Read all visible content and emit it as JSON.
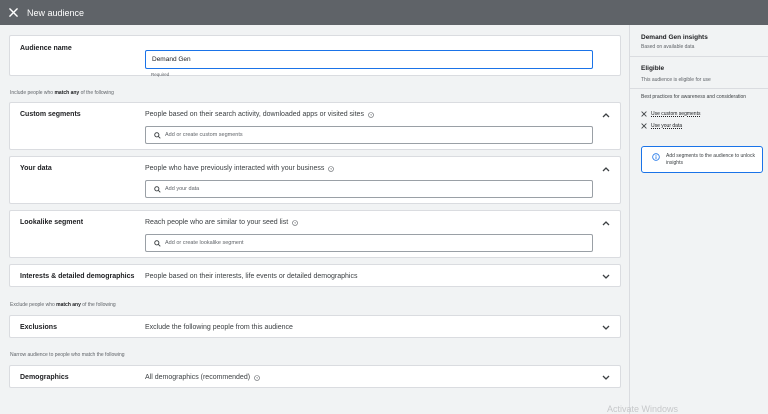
{
  "topbar": {
    "title": "New audience",
    "close_icon": "close-icon"
  },
  "audience_name": {
    "label": "Audience name",
    "value": "Demand Gen",
    "helper": "Required"
  },
  "include_caption": {
    "before": "Include people who ",
    "bold": "match any",
    "after": " of the following"
  },
  "custom_segments": {
    "label": "Custom segments",
    "description": "People based on their search activity, downloaded apps or visited sites",
    "placeholder": "Add or create custom segments"
  },
  "your_data": {
    "label": "Your data",
    "description": "People who have previously interacted with your business",
    "placeholder": "Add your data"
  },
  "lookalike": {
    "label": "Lookalike segment",
    "description": "Reach people who are similar to your seed list",
    "placeholder": "Add or create lookalike segment"
  },
  "interests": {
    "label": "Interests & detailed demographics",
    "description": "People based on their interests, life events or detailed demographics"
  },
  "exclude_caption": {
    "before": "Exclude people who ",
    "bold": "match any",
    "after": " of the following"
  },
  "exclusions": {
    "label": "Exclusions",
    "description": "Exclude the following people from this audience"
  },
  "narrow_caption": "Narrow audience to people who match the following",
  "demographics": {
    "label": "Demographics",
    "description": "All demographics (recommended)"
  },
  "insights": {
    "title": "Demand Gen insights",
    "subtitle": "Based on available data",
    "eligible_title": "Eligible",
    "eligible_text": "This audience is eligible for use",
    "best_practices": "Best practices for awareness and consideration",
    "items": [
      "Use custom segments",
      "Use your data"
    ],
    "info_text": "Add segments to the audience to unlock insights"
  },
  "watermark": "Activate Windows",
  "colors": {
    "topbar": "#5f6368",
    "accent": "#1a73e8",
    "background": "#f1f3f4"
  }
}
